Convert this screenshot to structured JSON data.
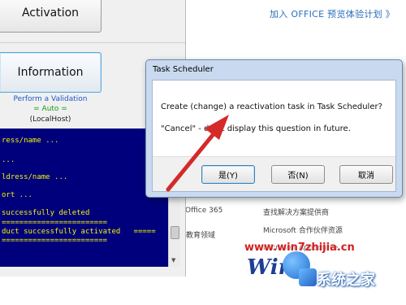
{
  "background_page": {
    "top_link": "加入 OFFICE 预览体验计划 》",
    "items": [
      "Office 365",
      "查找解决方案提供商",
      "Microsoft 合作伙伴资源",
      "Microsoft AppSource",
      "受教育领域"
    ],
    "watermark": "www.win7zhijia.cn",
    "brand": "系统之家"
  },
  "app": {
    "activation_button": "Activation",
    "information_button": "Information",
    "mode_label": "Perform a Validation",
    "mode_value": "= Auto =",
    "host": "(LocalHost)",
    "console_lines": [
      "ress/name ...",
      "...",
      "ldress/name ...",
      "ort ...",
      "successfully deleted",
      "========================",
      "duct successfully activated   =====",
      "========================"
    ]
  },
  "dialog": {
    "title": "Task Scheduler",
    "message1": "Create (change) a reactivation task in Task Scheduler?",
    "message2": "\"Cancel\" - don't display this question in future.",
    "yes_button": "是(Y)",
    "no_button": "否(N)",
    "cancel_button": "取消"
  },
  "colors": {
    "console_bg": "#00007c",
    "console_text": "#f5f500",
    "arrow": "#d42a2a",
    "link": "#2a6ebb"
  }
}
